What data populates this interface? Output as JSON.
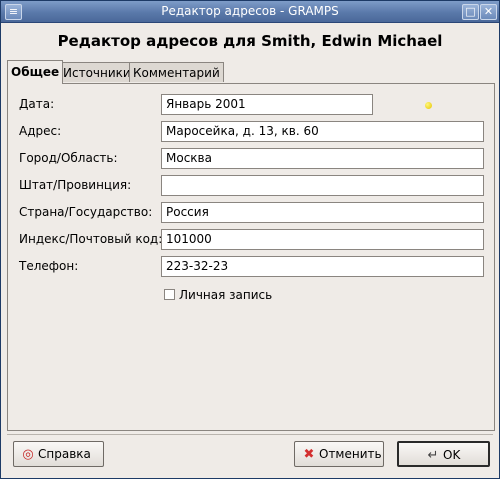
{
  "window": {
    "title": "Редактор адресов - GRAMPS",
    "heading": "Редактор адресов для Smith, Edwin Michael",
    "controls": {
      "menu": "≡",
      "maximize": "□",
      "close": "✕"
    }
  },
  "tabs": [
    {
      "label": "Общее",
      "active": true
    },
    {
      "label": "Источники",
      "active": false
    },
    {
      "label": "Комментарий",
      "active": false
    }
  ],
  "form": {
    "date": {
      "label": "Дата:",
      "value": "Январь 2001"
    },
    "address": {
      "label": "Адрес:",
      "value": "Маросейка, д. 13, кв. 60"
    },
    "city": {
      "label": "Город/Область:",
      "value": "Москва"
    },
    "state": {
      "label": "Штат/Провинция:",
      "value": ""
    },
    "country": {
      "label": "Страна/Государство:",
      "value": "Россия"
    },
    "postal": {
      "label": "Индекс/Почтовый код:",
      "value": "101000"
    },
    "phone": {
      "label": "Телефон:",
      "value": "223-32-23"
    },
    "private": {
      "label": "Личная запись",
      "checked": false
    }
  },
  "buttons": {
    "help": "Справка",
    "cancel": "Отменить",
    "ok": "OK"
  },
  "colors": {
    "titlebar": "#5a79aa",
    "background": "#efebe7",
    "date_indicator": "#f5dc00"
  },
  "icons": {
    "help": "lifebuoy-icon",
    "cancel": "red-x-icon",
    "ok": "enter-arrow-icon",
    "date_status": "yellow-dot-icon"
  }
}
